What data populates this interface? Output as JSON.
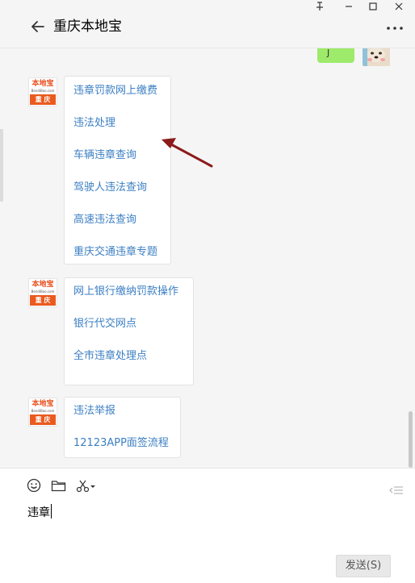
{
  "window": {
    "pin_icon": "pin-icon",
    "minimize_icon": "minimize-icon",
    "maximize_icon": "maximize-icon",
    "close_icon": "close-icon"
  },
  "header": {
    "title": "重庆本地宝",
    "back_icon": "back-arrow-icon",
    "more_icon": "more-icon"
  },
  "chat": {
    "my_message": {
      "text": "J",
      "avatar": "user-avatar"
    },
    "official_avatar": {
      "logo_top": "本地宝",
      "logo_mid": "BendiBao.com",
      "logo_bottom": "重 庆"
    },
    "menus": [
      {
        "items": [
          "违章罚款网上缴费",
          "违法处理",
          "车辆违章查询",
          "驾驶人违法查询",
          "高速违法查询",
          "重庆交通违章专题"
        ]
      },
      {
        "items": [
          "网上银行缴纳罚款操作",
          "银行代交网点",
          "全市违章处理点"
        ]
      },
      {
        "items": [
          "违法举报",
          "12123APP面签流程"
        ]
      }
    ],
    "annotation": "red-arrow-pointer",
    "annotation_color": "#8b1a1a"
  },
  "composer": {
    "emoji_icon": "emoji-icon",
    "folder_icon": "folder-icon",
    "scissors_icon": "scissors-icon",
    "chat_history_icon": "list-icon",
    "input_value": "违章",
    "send_label": "发送(S)"
  },
  "colors": {
    "link": "#3c7fc3",
    "my_bubble": "#9eea6a",
    "brand": "#ea5a1f"
  }
}
